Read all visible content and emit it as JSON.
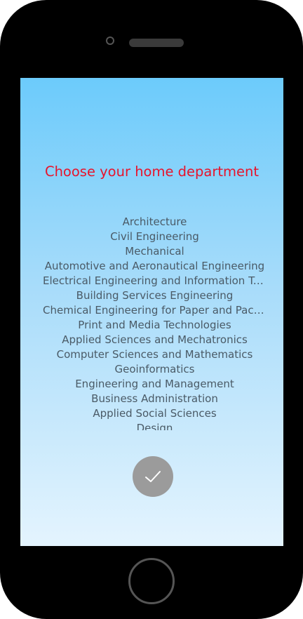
{
  "screen": {
    "title": "Choose your home department",
    "title_color": "#e8132b",
    "gradient_top": "#6ccbfb",
    "gradient_bottom": "#e4f4fe"
  },
  "departments": [
    "Architecture",
    "Civil Engineering",
    "Mechanical",
    "Automotive and Aeronautical Engineering",
    "Electrical Engineering and Information Tec...",
    "Building Services Engineering",
    "Chemical Engineering for Paper and Packa...",
    "Print and Media Technologies",
    "Applied Sciences and Mechatronics",
    "Computer Sciences and Mathematics",
    "Geoinformatics",
    "Engineering and Management",
    "Business Administration",
    "Applied Social Sciences",
    "Design"
  ],
  "confirm_button": {
    "icon": "checkmark-icon",
    "color": "#9b9b9b"
  },
  "device": {
    "frame_color": "#000000",
    "camera_icon": "camera-icon",
    "speaker_icon": "speaker-grille",
    "home_icon": "home-button-icon"
  }
}
